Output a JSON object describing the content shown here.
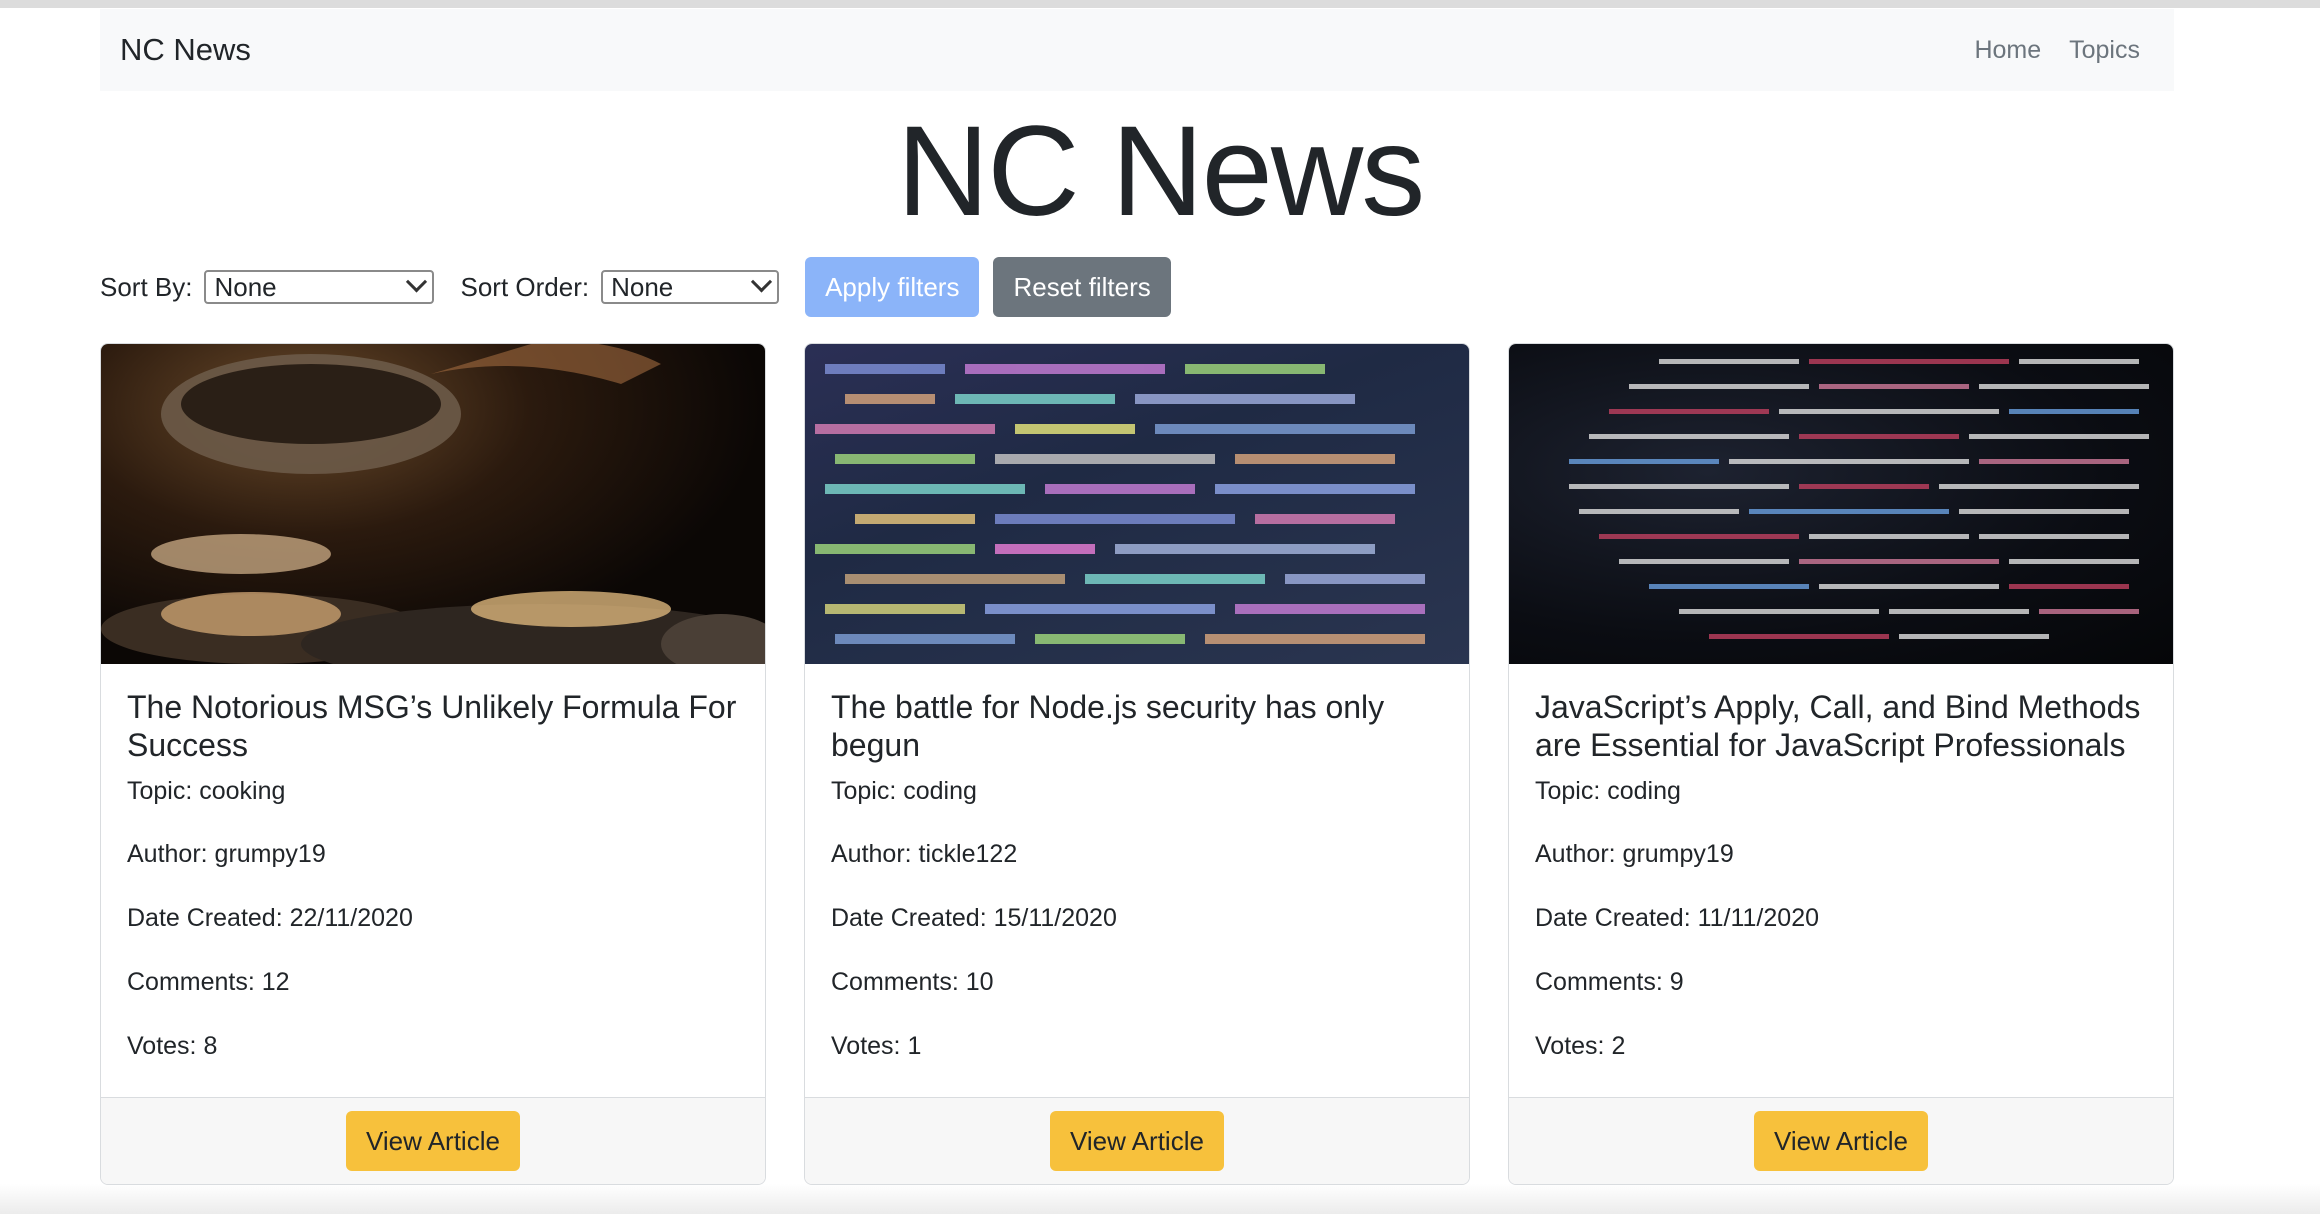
{
  "navbar": {
    "brand": "NC News",
    "links": [
      "Home",
      "Topics"
    ]
  },
  "header": {
    "title": "NC News"
  },
  "filters": {
    "sort_by_label": "Sort By:",
    "sort_by_value": "None",
    "sort_order_label": "Sort Order:",
    "sort_order_value": "None",
    "apply_label": "Apply filters",
    "reset_label": "Reset filters"
  },
  "articles": [
    {
      "title": "The Notorious MSG’s Unlikely Formula For Success",
      "topic": "Topic: cooking",
      "author": "Author: grumpy19",
      "date": "Date Created: 22/11/2020",
      "comments": "Comments: 12",
      "votes": "Votes: 8",
      "button": "View Article"
    },
    {
      "title": "The battle for Node.js security has only begun",
      "topic": "Topic: coding",
      "author": "Author: tickle122",
      "date": "Date Created: 15/11/2020",
      "comments": "Comments: 10",
      "votes": "Votes: 1",
      "button": "View Article"
    },
    {
      "title": "JavaScript’s Apply, Call, and Bind Methods are Essential for JavaScript Professionals",
      "topic": "Topic: coding",
      "author": "Author: grumpy19",
      "date": "Date Created: 11/11/2020",
      "comments": "Comments: 9",
      "votes": "Votes: 2",
      "button": "View Article"
    }
  ],
  "colors": {
    "apply": "#8bb4f9",
    "reset": "#6c757d",
    "view": "#f7c13c",
    "navbar_bg": "#f8f9fa"
  }
}
